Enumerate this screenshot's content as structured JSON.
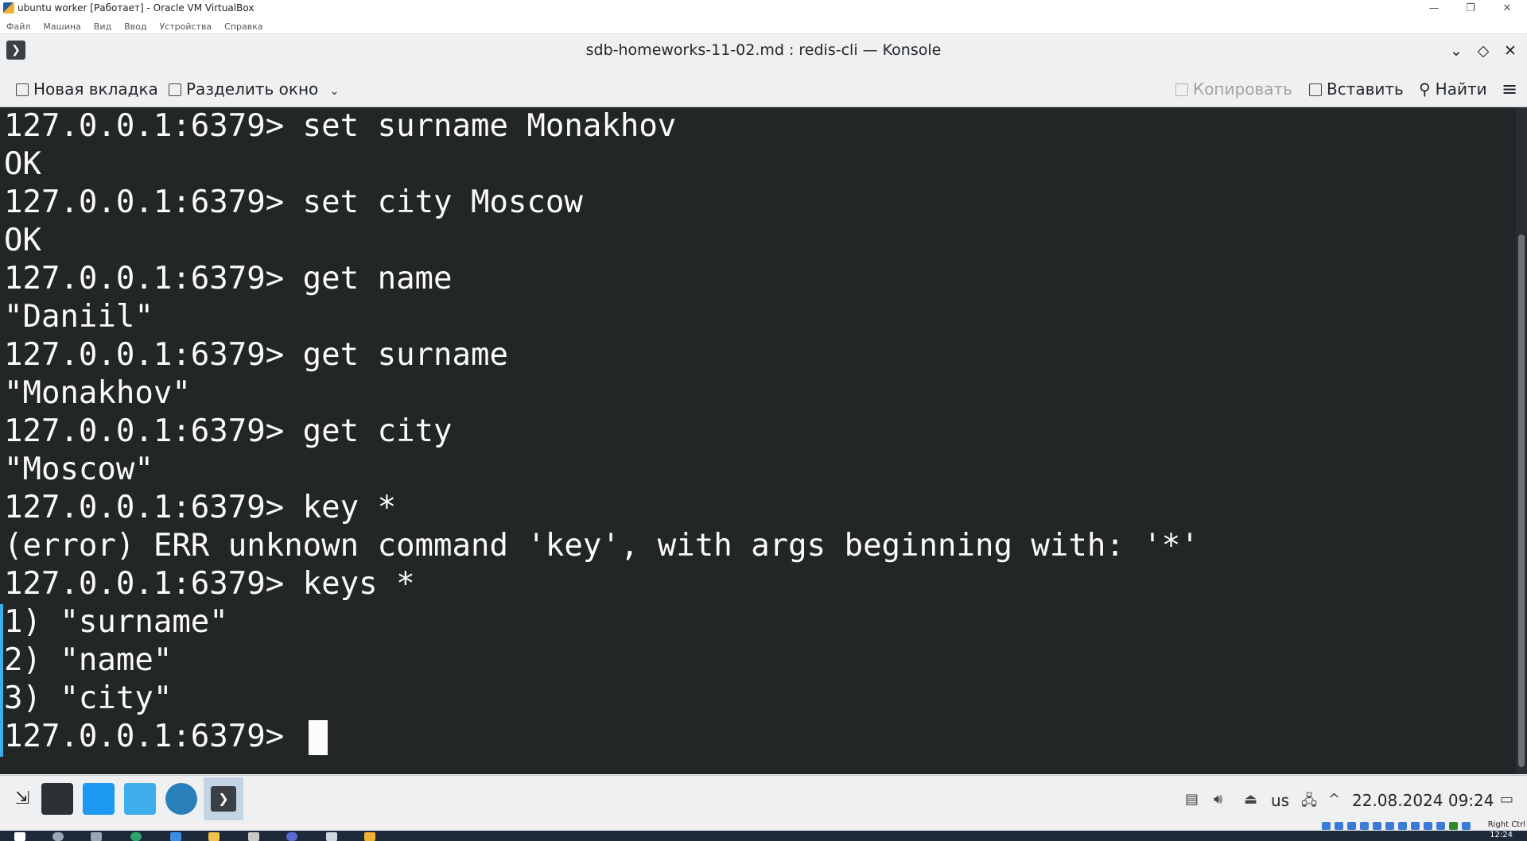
{
  "host_window": {
    "title": "ubuntu worker [Работает] - Oracle VM VirtualBox",
    "menu": [
      "Файл",
      "Машина",
      "Вид",
      "Ввод",
      "Устройства",
      "Справка"
    ]
  },
  "konsole": {
    "title": "sdb-homeworks-11-02.md : redis-cli — Konsole",
    "toolbar": {
      "new_tab": "Новая вкладка",
      "split_view": "Разделить окно",
      "copy": "Копировать",
      "paste": "Вставить",
      "find": "Найти"
    }
  },
  "terminal": {
    "lines": [
      "127.0.0.1:6379> set surname Monakhov",
      "OK",
      "127.0.0.1:6379> set city Moscow",
      "OK",
      "127.0.0.1:6379> get name",
      "\"Daniil\"",
      "127.0.0.1:6379> get surname",
      "\"Monakhov\"",
      "127.0.0.1:6379> get city",
      "\"Moscow\"",
      "127.0.0.1:6379> key *",
      "(error) ERR unknown command 'key', with args beginning with: '*'",
      "127.0.0.1:6379> keys *",
      "1) \"surname\"",
      "2) \"name\"",
      "3) \"city\"",
      "127.0.0.1:6379> "
    ]
  },
  "panel": {
    "keyboard_layout": "us",
    "datetime": "22.08.2024  09:24"
  },
  "vbox_status": {
    "host_key": "Right Ctrl"
  },
  "host_taskbar": {
    "clock": "12:24"
  },
  "colors": {
    "terminal_bg": "#232627",
    "terminal_fg": "#fcfcfc",
    "accent": "#3daee9"
  }
}
